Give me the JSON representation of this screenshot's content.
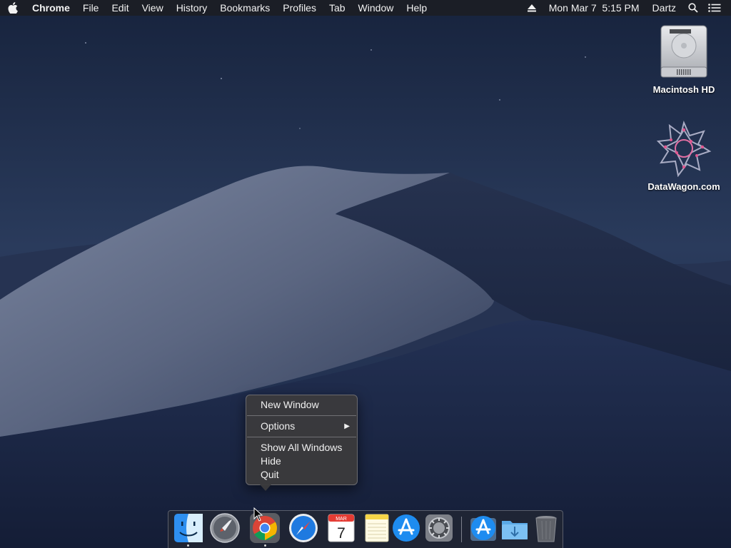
{
  "menubar": {
    "app_name": "Chrome",
    "menus": [
      "File",
      "Edit",
      "View",
      "History",
      "Bookmarks",
      "Profiles",
      "Tab",
      "Window",
      "Help"
    ],
    "datetime": "Mon Mar 7  5:15 PM",
    "user": "Dartz",
    "icons": [
      "apple-icon",
      "eject-icon",
      "spotlight-search-icon",
      "notification-list-icon"
    ]
  },
  "desktop": {
    "icons": [
      {
        "label": "Macintosh HD",
        "icon": "hard-drive-icon"
      },
      {
        "label": "DataWagon.com",
        "icon": "datawagon-logo-icon"
      }
    ]
  },
  "context_menu": {
    "items": [
      "New Window",
      "Options",
      "Show All Windows",
      "Hide",
      "Quit"
    ],
    "submenu_arrow": "▶"
  },
  "dock": {
    "calendar": {
      "month": "MAR",
      "day": "7"
    },
    "apps": [
      "finder-icon",
      "launchpad-icon",
      "chrome-icon",
      "safari-icon",
      "calendar-icon",
      "notes-icon",
      "app-store-icon",
      "system-preferences-icon",
      "app-store-downloads-icon",
      "downloads-folder-icon",
      "trash-icon"
    ]
  }
}
